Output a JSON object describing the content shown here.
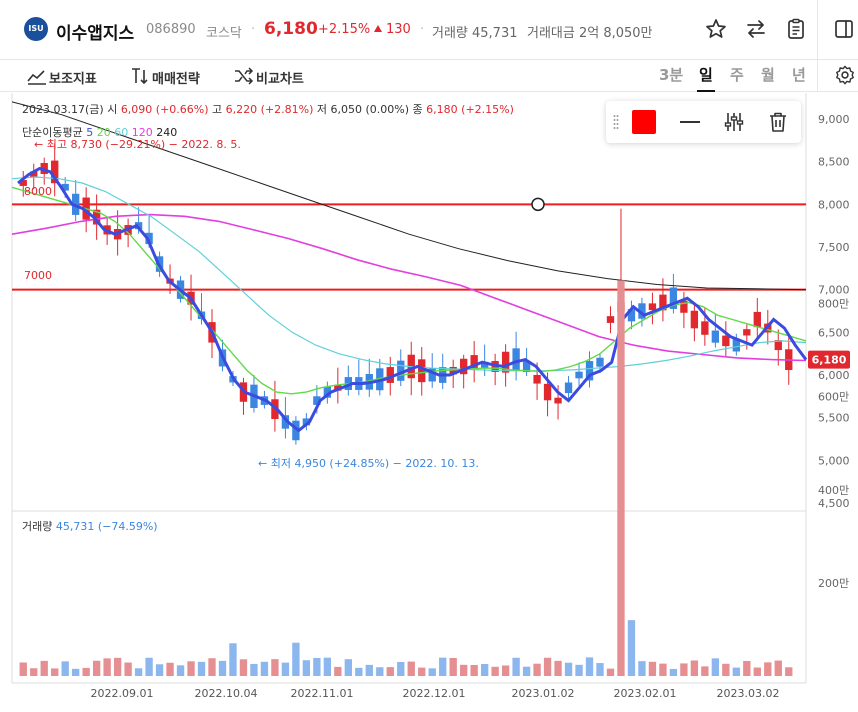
{
  "header": {
    "logo_text": "ISU",
    "name": "이수앱지스",
    "code": "086890",
    "market": "코스닥",
    "price": "6,180",
    "change_pct": "+2.15%",
    "change_abs": "130",
    "volume_text": "거래량 45,731",
    "amount_text": "거래대금 2억 8,050만",
    "icons": [
      "star-icon",
      "swap-icon",
      "clipboard-icon",
      "panel-icon"
    ]
  },
  "toolbar": {
    "indicators": "보조지표",
    "strategy": "매매전략",
    "compare": "비교차트",
    "periods": [
      "3분",
      "일",
      "주",
      "월",
      "년"
    ],
    "active_period": "일"
  },
  "ohlc_line": {
    "date": "2023.03.17(금)",
    "open_lbl": "시",
    "open": "6,090 (+0.66%)",
    "high_lbl": "고",
    "high": "6,220 (+2.81%)",
    "low_lbl": "저",
    "low": "6,050 (0.00%)",
    "close_lbl": "종",
    "close": "6,180 (+2.15%)"
  },
  "ma_legend": {
    "label": "단순이동평균",
    "periods": [
      "5",
      "20",
      "60",
      "120",
      "240"
    ],
    "colors": [
      "#3b4be0",
      "#62d94a",
      "#5fd0d8",
      "#e23ee0",
      "#222222"
    ]
  },
  "annotations": {
    "high": "← 최고 8,730 (−29.21%) − 2022. 8. 5.",
    "low": "← 최저 4,950 (+24.85%) − 2022. 10. 13.",
    "line_8000": "8000",
    "line_7000": "7000"
  },
  "volume_legend": {
    "label": "거래량",
    "value": "45,731 (−74.59%)"
  },
  "price_tag": "6,180",
  "colors": {
    "up": "#e0282e",
    "down": "#3b86e0",
    "hline": "#ee1c1c",
    "swatch": "#ff0000"
  },
  "chart_data": {
    "type": "candlestick",
    "price_axis": {
      "ticks": [
        "4,500",
        "5,000",
        "5,500",
        "6,000",
        "6,500",
        "7,000",
        "7,500",
        "8,000",
        "8,500",
        "9,000"
      ],
      "ylim": [
        4500,
        9000
      ]
    },
    "volume_axis": {
      "ticks": [
        "200만",
        "400만",
        "600만",
        "800만"
      ],
      "ylim": [
        0,
        900
      ]
    },
    "x_ticks": [
      "2022.09.01",
      "2022.10.04",
      "2022.11.01",
      "2022.12.01",
      "2023.01.02",
      "2023.02.01",
      "2023.03.02"
    ],
    "horizontal_lines": [
      8000,
      7000
    ],
    "ma5": [
      8250,
      8350,
      8420,
      8380,
      8200,
      8000,
      7950,
      7850,
      7700,
      7650,
      7700,
      7750,
      7600,
      7300,
      7100,
      7000,
      6900,
      6700,
      6500,
      6200,
      5950,
      5800,
      5750,
      5700,
      5600,
      5450,
      5350,
      5450,
      5700,
      5800,
      5850,
      5900,
      5900,
      5920,
      5950,
      6000,
      6050,
      6100,
      6050,
      6000,
      6000,
      6050,
      6100,
      6150,
      6120,
      6100,
      6150,
      6180,
      6100,
      5950,
      5800,
      5700,
      5850,
      6000,
      6050,
      6150,
      6650,
      6800,
      6700,
      6750,
      6800,
      6850,
      6900,
      6800,
      6650,
      6550,
      6450,
      6400,
      6350,
      6500,
      6650,
      6550,
      6350,
      6180
    ],
    "ma20": [
      8200,
      8150,
      8100,
      8050,
      8000,
      7950,
      7900,
      7800,
      7650,
      7450,
      7250,
      7050,
      6850,
      6650,
      6450,
      6250,
      6050,
      5900,
      5800,
      5780,
      5800,
      5850,
      5880,
      5900,
      5920,
      5960,
      5990,
      6010,
      6030,
      6050,
      6060,
      6070,
      6080,
      6080,
      6060,
      6050,
      6040,
      6060,
      6100,
      6160,
      6250,
      6400,
      6550,
      6650,
      6750,
      6820,
      6850,
      6800,
      6700,
      6650,
      6600,
      6550,
      6500,
      6450,
      6400
    ],
    "ma60": [
      8300,
      8320,
      8300,
      8250,
      8150,
      8000,
      7850,
      7650,
      7450,
      7200,
      6950,
      6700,
      6500,
      6350,
      6250,
      6180,
      6130,
      6100,
      6080,
      6070,
      6060,
      6050,
      6050,
      6050,
      6060,
      6080,
      6100,
      6130,
      6170,
      6220,
      6280,
      6330,
      6380,
      6400,
      6380
    ],
    "ma120": [
      7650,
      7720,
      7800,
      7860,
      7880,
      7860,
      7800,
      7700,
      7600,
      7480,
      7350,
      7240,
      7150,
      7050,
      6900,
      6750,
      6600,
      6450,
      6350,
      6280,
      6240,
      6200,
      6180,
      6170
    ],
    "ma240": [
      9200,
      9050,
      8850,
      8650,
      8450,
      8250,
      8050,
      7850,
      7650,
      7480,
      7340,
      7220,
      7130,
      7060,
      7020,
      7010,
      7000
    ],
    "volume_spike": 850
  }
}
